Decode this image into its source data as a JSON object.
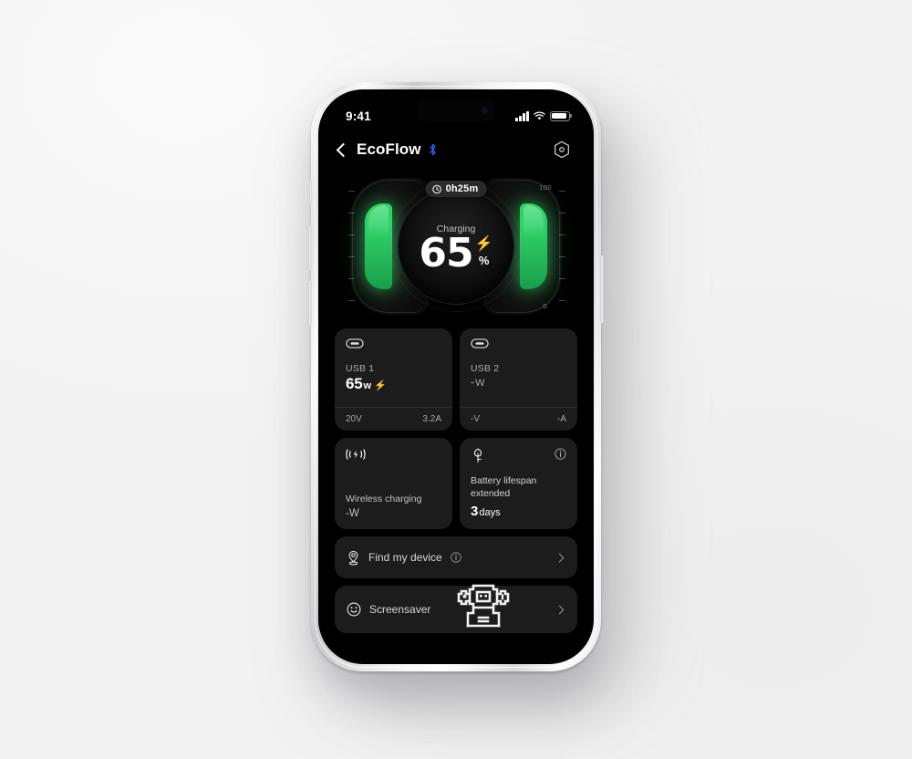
{
  "status_bar": {
    "time": "9:41",
    "signal_icon": "cellular-bars-icon",
    "wifi_icon": "wifi-icon",
    "battery_icon": "battery-icon"
  },
  "nav": {
    "back_icon": "chevron-left-icon",
    "title": "EcoFlow",
    "bluetooth_icon": "bluetooth-icon",
    "settings_icon": "gear-icon"
  },
  "gauge": {
    "time_remaining": "0h25m",
    "clock_icon": "clock-icon",
    "status_label": "Charging",
    "percent": "65",
    "percent_sign": "%",
    "bolt_icon": "lightning-bolt-icon",
    "scale_max": "100",
    "scale_min": "0",
    "fill_percent": 65,
    "accent_color": "#2dd663"
  },
  "ports": [
    {
      "icon": "usb-c-port-icon",
      "name": "USB 1",
      "power": "65",
      "power_unit": "w",
      "charging_bolt": "lightning-bolt-icon",
      "voltage": "20V",
      "current": "3.2A",
      "active": true
    },
    {
      "icon": "usb-c-port-icon",
      "name": "USB 2",
      "power": "-",
      "power_unit": "W",
      "voltage": "-V",
      "current": "-A",
      "active": false
    }
  ],
  "wireless": {
    "icon": "wireless-charging-icon",
    "title": "Wireless charging",
    "value": "-W"
  },
  "lifespan": {
    "icon": "leaf-icon",
    "info_icon": "info-icon",
    "title": "Battery lifespan extended",
    "value": "3",
    "unit": "days"
  },
  "rows": [
    {
      "icon": "location-pin-icon",
      "label": "Find my device",
      "info_icon": "info-icon",
      "chevron": "chevron-right-icon"
    },
    {
      "icon": "smiley-face-icon",
      "label": "Screensaver",
      "graphic": "pixel-robot-icon",
      "chevron": "chevron-right-icon"
    }
  ]
}
